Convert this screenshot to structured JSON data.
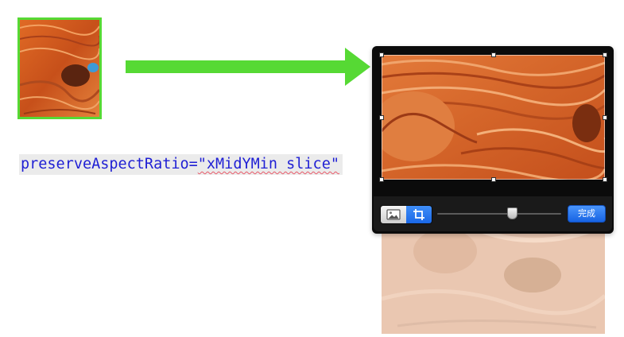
{
  "code_label": {
    "attr_name": "preserveAspectRatio=",
    "attr_value": "\"xMidYMin slice\""
  },
  "colors": {
    "arrow": "#56d934",
    "thumbnail_border": "#56d934",
    "code_text": "#1f1fd4",
    "code_background": "#ebebeb",
    "done_button": "#1a6ae6"
  },
  "crop_toolbar": {
    "image_mode_icon": "photo-icon",
    "crop_mode_icon": "crop-icon",
    "active_mode": "crop",
    "zoom_level_fraction": 0.6,
    "done_label": "完成"
  }
}
